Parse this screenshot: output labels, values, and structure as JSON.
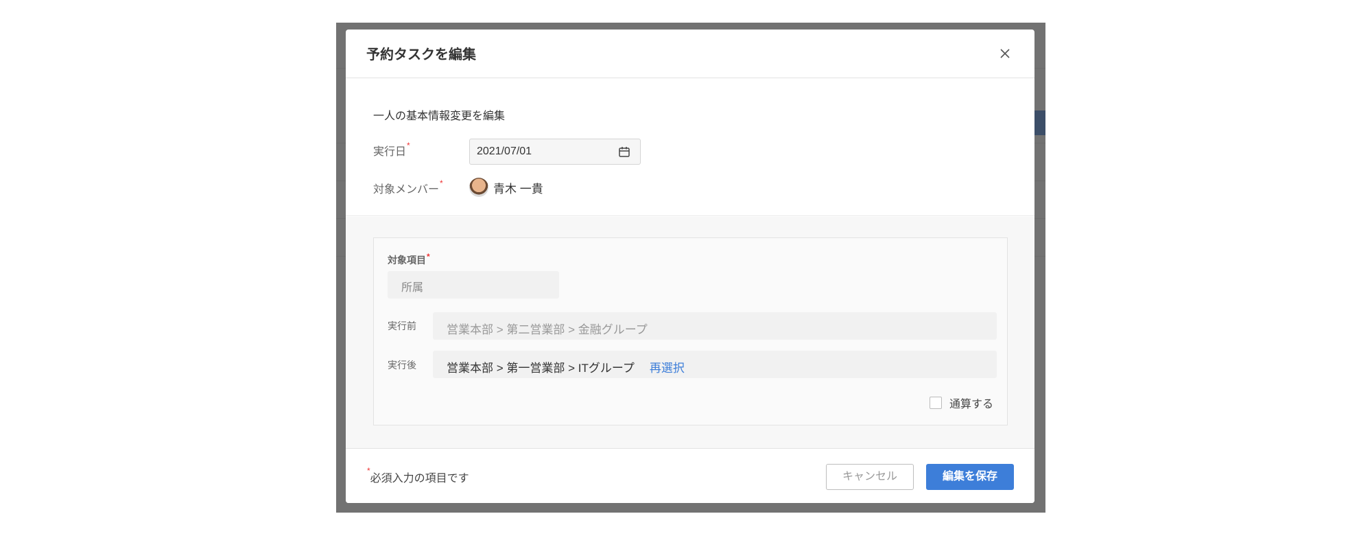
{
  "modal": {
    "title": "予約タスクを編集",
    "description": "一人の基本情報変更を編集",
    "execution_date_label": "実行日",
    "execution_date_value": "2021/07/01",
    "target_member_label": "対象メンバー",
    "member_name": "青木 一貴",
    "required_mark": "*"
  },
  "card": {
    "target_item_label": "対象項目",
    "target_item_value": "所属",
    "before_label": "実行前",
    "before_value": "営業本部 > 第二営業部 > 金融グループ",
    "after_label": "実行後",
    "after_value": "営業本部 > 第一営業部 > ITグループ",
    "reselect_label": "再選択",
    "checkbox_label": "通算する",
    "checkbox_checked": false
  },
  "footer": {
    "required_note": "必須入力の項目です",
    "cancel_label": "キャンセル",
    "save_label": "編集を保存"
  },
  "colors": {
    "accent": "#3d7ed9",
    "required": "#ee3333"
  },
  "icons": {
    "close": "close-icon",
    "calendar": "calendar-icon"
  }
}
